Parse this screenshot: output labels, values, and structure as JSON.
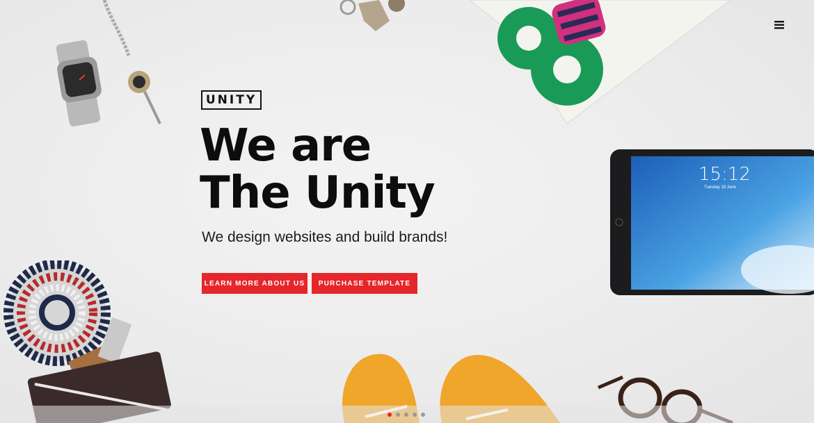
{
  "brand": {
    "logo": "UNITY"
  },
  "hero": {
    "headline_line1": "We are",
    "headline_line2": "The Unity",
    "tagline": "We design websites and build brands!",
    "buttons": {
      "learn_more": "LEARN MORE ABOUT US",
      "purchase": "PURCHASE TEMPLATE"
    }
  },
  "tablet": {
    "time": "15:12",
    "date": "Tuesday 18 June"
  },
  "slider": {
    "count": 5,
    "active_index": 0
  },
  "colors": {
    "accent": "#e5262b",
    "text": "#0d0d0d",
    "background": "#ececec"
  },
  "icons": {
    "menu": "hamburger-menu-icon"
  }
}
